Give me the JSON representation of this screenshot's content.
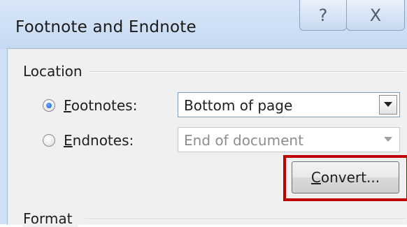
{
  "dialog": {
    "title": "Footnote and Endnote",
    "help_glyph": "?",
    "close_glyph": "X"
  },
  "location": {
    "group_label": "Location",
    "footnotes": {
      "label_mnemonic": "F",
      "label_rest": "ootnotes:",
      "selected": true,
      "value": "Bottom of page"
    },
    "endnotes": {
      "label_mnemonic": "E",
      "label_rest": "ndnotes:",
      "selected": false,
      "value": "End of document",
      "enabled": false
    },
    "convert_button": {
      "label_mnemonic": "C",
      "label_rest": "onvert..."
    }
  },
  "format": {
    "group_label": "Format"
  },
  "colors": {
    "highlight": "#c00000"
  }
}
